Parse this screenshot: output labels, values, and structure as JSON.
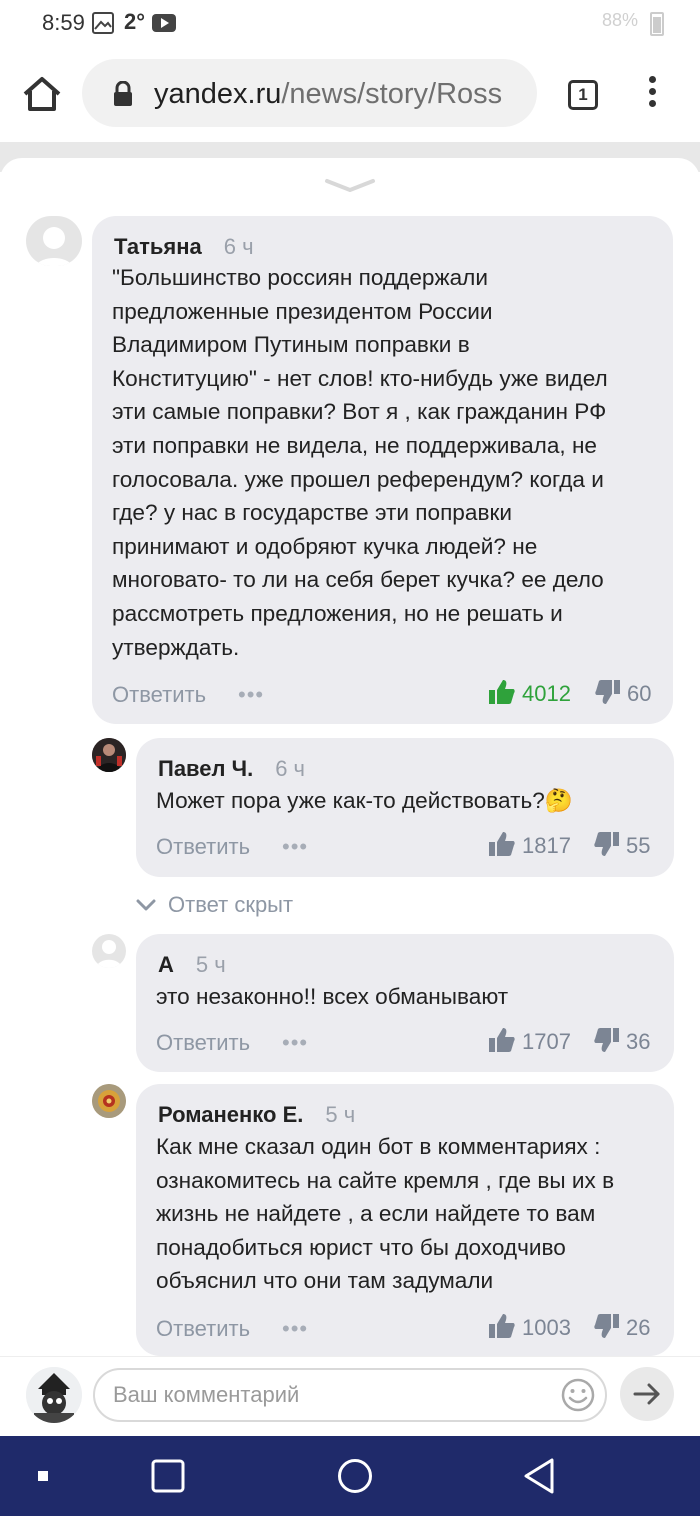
{
  "status_bar": {
    "time": "8:59",
    "temperature": "2°",
    "battery": "88%",
    "icons": [
      "image-icon",
      "youtube-icon",
      "battery-icon"
    ]
  },
  "browser": {
    "url_domain": "yandex.ru",
    "url_path": "/news/story/Ross",
    "tab_count": "1",
    "icons": [
      "home-icon",
      "lock-icon",
      "menu-icon"
    ]
  },
  "comments": [
    {
      "author": "Татьяна",
      "time": "6 ч",
      "lines": [
        "\"Большинство россиян поддержали",
        "предложенные президентом России",
        "Владимиром Путиным поправки в",
        "Конституцию\" - нет слов! кто-нибудь уже видел",
        "эти самые поправки?  Вот я , как гражданин РФ",
        "эти поправки не видела, не поддерживала, не",
        "голосовала.  уже прошел референдум?  когда и",
        "где? у нас в государстве эти поправки",
        "принимают и одобряют кучка людей? не",
        "многовато- то ли на себя берет кучка? ее дело",
        "рассмотреть предложения, но не решать и",
        "утверждать."
      ],
      "reply_label": "Ответить",
      "more": "•••",
      "likes": "4012",
      "dislikes": "60",
      "liked": true
    },
    {
      "author": "Павел Ч.",
      "time": "6 ч",
      "lines": [
        "Может пора уже как-то действовать?🤔"
      ],
      "reply_label": "Ответить",
      "more": "•••",
      "likes": "1817",
      "dislikes": "55",
      "liked": false
    },
    {
      "author": "А",
      "time": "5 ч",
      "lines": [
        "это незаконно!! всех обманывают"
      ],
      "reply_label": "Ответить",
      "more": "•••",
      "likes": "1707",
      "dislikes": "36",
      "liked": false
    },
    {
      "author": "Романенко Е.",
      "time": "5 ч",
      "lines": [
        "Как мне сказал один бот в комментариях :",
        "ознакомитесь на сайте кремля , где вы их в",
        "жизнь не найдете , а если найдете то вам",
        "понадобиться юрист что бы доходчиво",
        "объяснил что они там задумали"
      ],
      "reply_label": "Ответить",
      "more": "•••",
      "likes": "1003",
      "dislikes": "26",
      "liked": false
    }
  ],
  "hidden_reply_label": "Ответ скрыт",
  "composer": {
    "placeholder": "Ваш комментарий",
    "value": ""
  },
  "colors": {
    "bubble": "#ececf0",
    "like_active": "#2fa23b",
    "nav_bar": "#1f2a6a"
  }
}
